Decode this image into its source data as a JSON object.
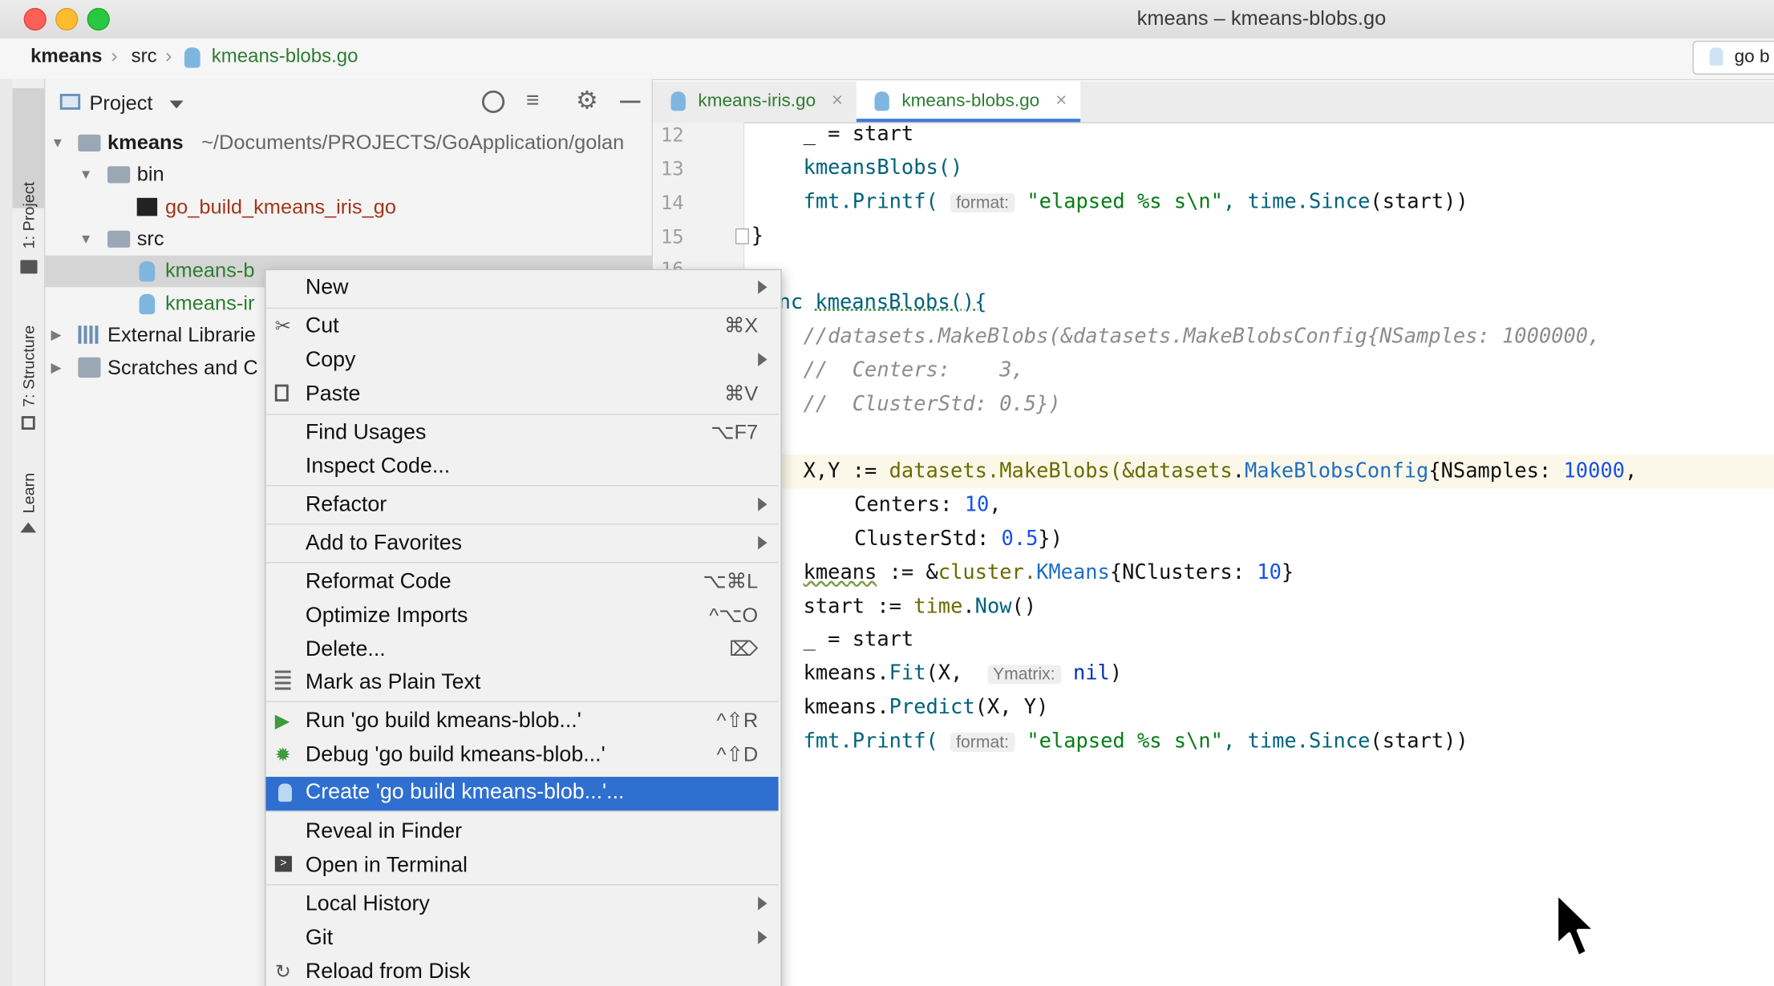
{
  "window": {
    "title": "kmeans – kmeans-blobs.go"
  },
  "breadcrumb": {
    "project": "kmeans",
    "folder": "src",
    "file": "kmeans-blobs.go"
  },
  "run_config": {
    "label": "go b"
  },
  "tool_windows": {
    "project": "1: Project",
    "structure": "7: Structure",
    "learn": "Learn"
  },
  "project_panel": {
    "title": "Project",
    "tree": {
      "root": {
        "name": "kmeans",
        "path": "~/Documents/PROJECTS/GoApplication/golan"
      },
      "bin": "bin",
      "binary": "go_build_kmeans_iris_go",
      "src": "src",
      "file1": "kmeans-b",
      "file2": "kmeans-ir",
      "external": "External Librarie",
      "scratches": "Scratches and C"
    }
  },
  "tabs": [
    {
      "label": "kmeans-iris.go"
    },
    {
      "label": "kmeans-blobs.go"
    }
  ],
  "editor": {
    "line_numbers": [
      "12",
      "13",
      "14",
      "15",
      "16"
    ],
    "lines": {
      "l12": "_ = start",
      "l13": "kmeansBlobs()",
      "l14_a": "fmt.",
      "l14_b": "Printf(",
      "l14_hint": "format:",
      "l14_c": "\"elapsed %s s\\n\"",
      "l14_d": ", time.",
      "l14_e": "Since",
      "l14_f": "(start))",
      "l15": "}",
      "l17_a": "nc ",
      "l17_b": "kmeansBlobs(){",
      "c1": "//datasets.MakeBlobs(&datasets.MakeBlobsConfig{NSamples: 1000000,",
      "c2": "//  Centers:    3,",
      "c3": "//  ClusterStd: 0.5})",
      "x1_a": "X,Y := ",
      "x1_b": "datasets",
      "x1_c": ".MakeBlobs(&",
      "x1_d": "datasets",
      "x1_e": ".",
      "x1_f": "MakeBlobsConfig",
      "x1_g": "{NSamples: ",
      "x1_h": "10000",
      "x1_i": ",",
      "x2_a": "Centers: ",
      "x2_b": "10",
      "x2_c": ",",
      "x3_a": "ClusterStd: ",
      "x3_b": "0.5",
      "x3_c": "})",
      "k1_a": "kmeans",
      "k1_b": " := &",
      "k1_c": "cluster",
      "k1_d": ".",
      "k1_e": "KMeans",
      "k1_f": "{NClusters: ",
      "k1_g": "10",
      "k1_h": "}",
      "s1_a": "start := ",
      "s1_b": "time",
      "s1_c": ".",
      "s1_d": "Now",
      "s1_e": "()",
      "u1": "_ = start",
      "f1_a": "kmeans.",
      "f1_b": "Fit",
      "f1_c": "(X, ",
      "f1_hint": "Ymatrix:",
      "f1_d": "nil",
      "f1_e": ")",
      "p1_a": "kmeans.",
      "p1_b": "Predict",
      "p1_c": "(X, Y)",
      "e1_a": "fmt.",
      "e1_b": "Printf(",
      "e1_hint": "format:",
      "e1_c": "\"elapsed %s s\\n\"",
      "e1_d": ", time.",
      "e1_e": "Since",
      "e1_f": "(start))"
    }
  },
  "context_menu": {
    "items": [
      {
        "label": "New",
        "shortcut": ""
      },
      {
        "label": "Cut",
        "shortcut": "⌘X"
      },
      {
        "label": "Copy",
        "shortcut": ""
      },
      {
        "label": "Paste",
        "shortcut": "⌘V"
      },
      {
        "label": "Find Usages",
        "shortcut": "⌥F7"
      },
      {
        "label": "Inspect Code...",
        "shortcut": ""
      },
      {
        "label": "Refactor",
        "shortcut": ""
      },
      {
        "label": "Add to Favorites",
        "shortcut": ""
      },
      {
        "label": "Reformat Code",
        "shortcut": "⌥⌘L"
      },
      {
        "label": "Optimize Imports",
        "shortcut": "^⌥O"
      },
      {
        "label": "Delete...",
        "shortcut": "⌦"
      },
      {
        "label": "Mark as Plain Text",
        "shortcut": ""
      },
      {
        "label": "Run 'go build kmeans-blob...'",
        "shortcut": "^⇧R"
      },
      {
        "label": "Debug 'go build kmeans-blob...'",
        "shortcut": "^⇧D"
      },
      {
        "label": "Create 'go build kmeans-blob...'...",
        "shortcut": ""
      },
      {
        "label": "Reveal in Finder",
        "shortcut": ""
      },
      {
        "label": "Open in Terminal",
        "shortcut": ""
      },
      {
        "label": "Local History",
        "shortcut": ""
      },
      {
        "label": "Git",
        "shortcut": ""
      },
      {
        "label": "Reload from Disk",
        "shortcut": ""
      }
    ]
  }
}
